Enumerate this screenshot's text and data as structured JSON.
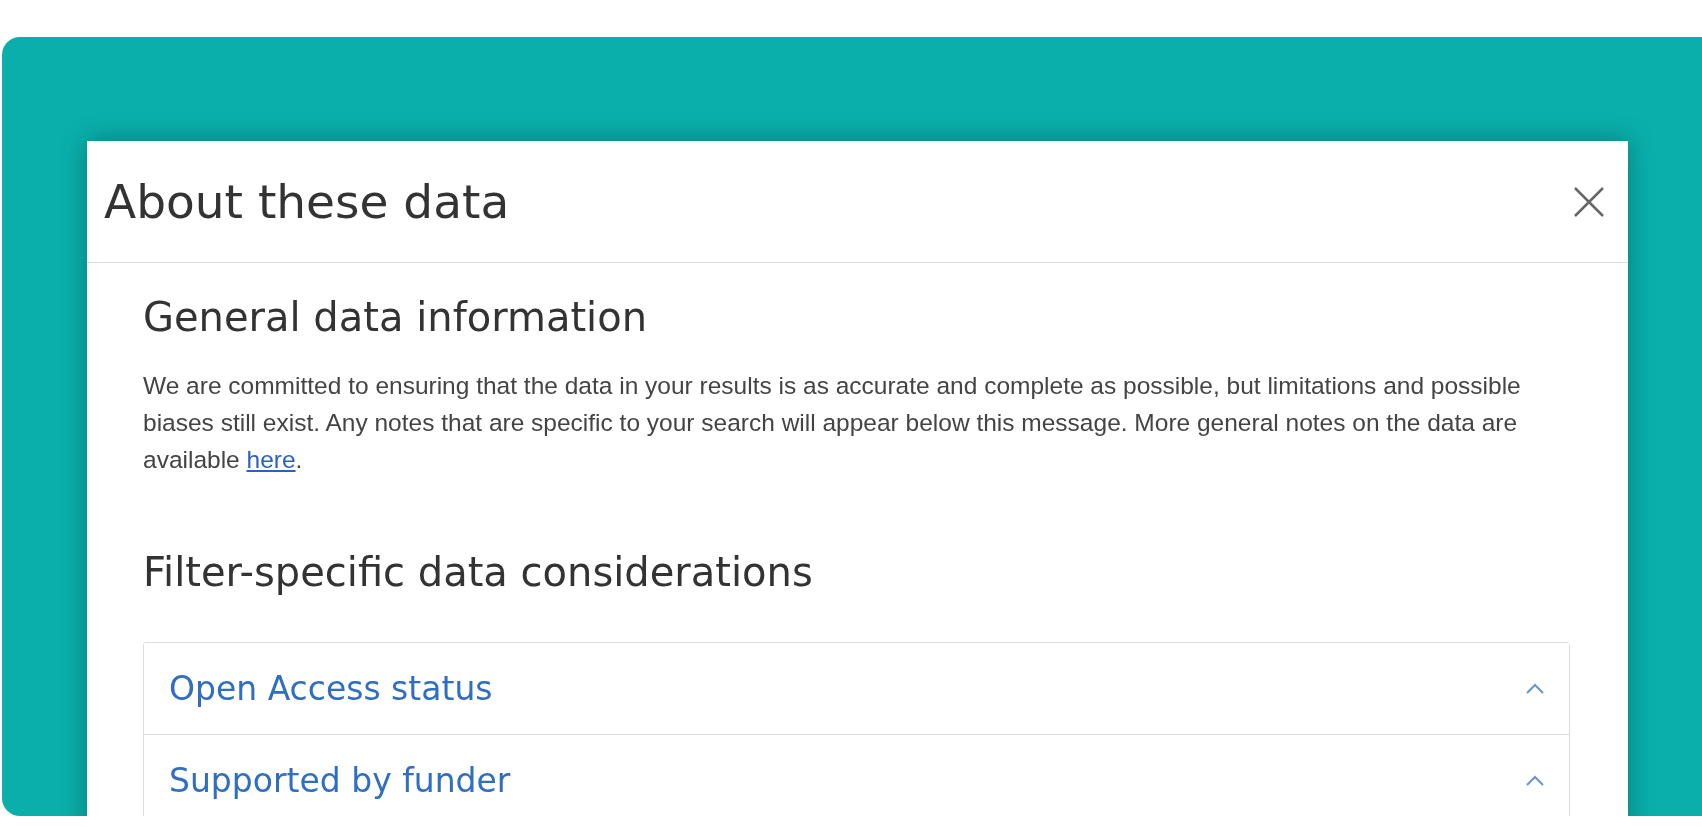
{
  "dialog": {
    "title": "About these data",
    "sections": [
      {
        "heading": "General data information",
        "paragraph": "We are committed to ensuring that the data in your results is as accurate and complete as possible, but limitations and possible biases still exist. Any notes that are specific to your search will appear below this message. More general notes on the data are available ",
        "link": "here",
        "after_link": "."
      },
      {
        "heading": "Filter-specific data considerations",
        "accordion": [
          {
            "label": "Open Access status"
          },
          {
            "label": "Supported by funder"
          }
        ]
      }
    ]
  }
}
